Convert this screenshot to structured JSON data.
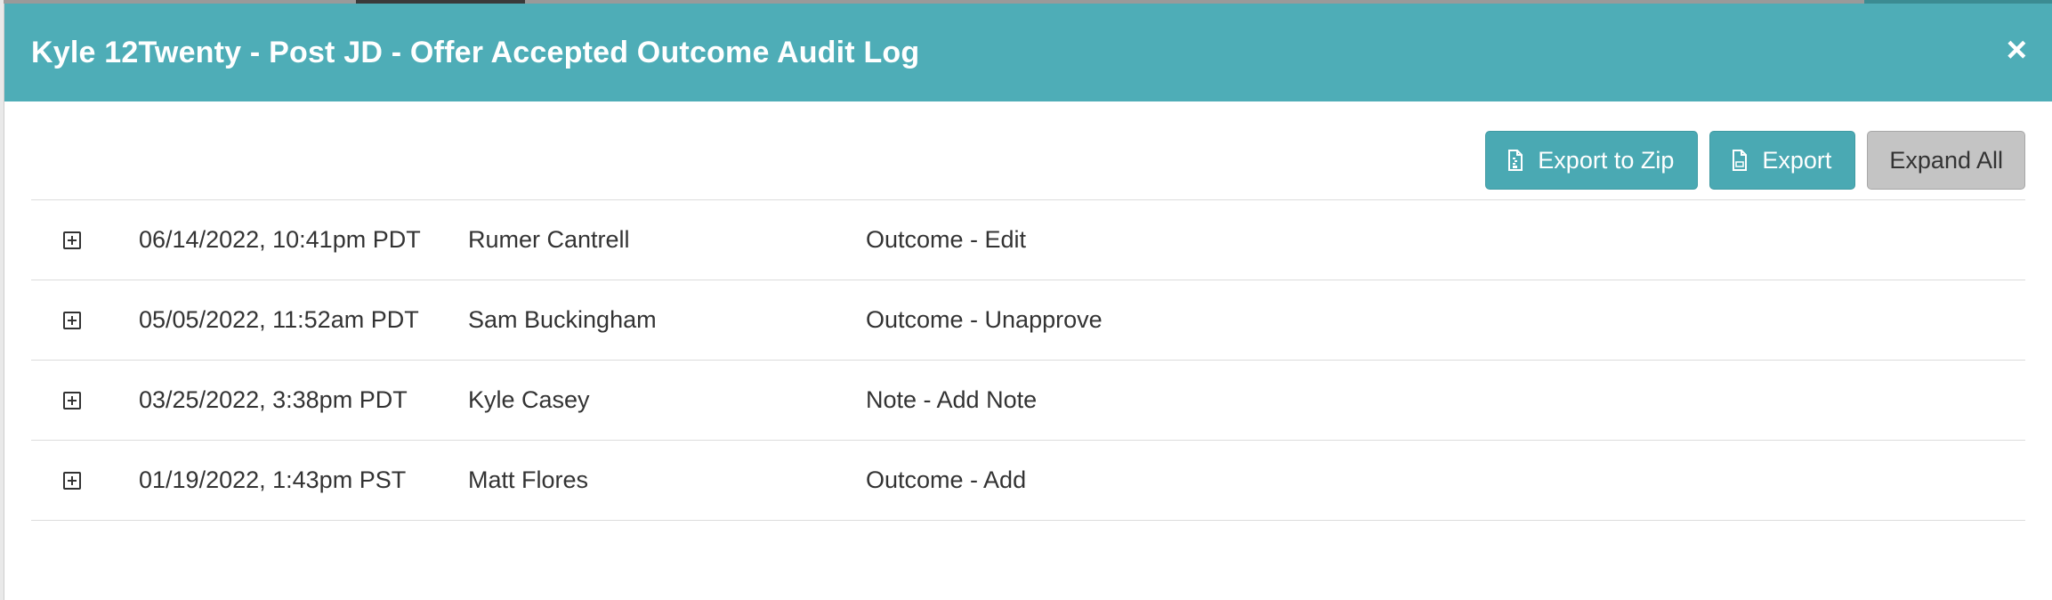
{
  "modal": {
    "title": "Kyle 12Twenty - Post JD - Offer Accepted Outcome Audit Log",
    "close_icon": "close-icon",
    "close_glyph": "×"
  },
  "toolbar": {
    "export_zip_label": "Export to Zip",
    "export_zip_icon": "zip-file-icon",
    "export_label": "Export",
    "export_icon": "csv-file-icon",
    "expand_all_label": "Expand All"
  },
  "log": {
    "rows": [
      {
        "timestamp": "06/14/2022, 10:41pm PDT",
        "user": "Rumer Cantrell",
        "action": "Outcome - Edit"
      },
      {
        "timestamp": "05/05/2022, 11:52am PDT",
        "user": "Sam Buckingham",
        "action": "Outcome - Unapprove"
      },
      {
        "timestamp": "03/25/2022, 3:38pm PDT",
        "user": "Kyle Casey",
        "action": "Note - Add Note"
      },
      {
        "timestamp": "01/19/2022, 1:43pm PST",
        "user": "Matt Flores",
        "action": "Outcome - Add"
      }
    ]
  },
  "colors": {
    "header_bg": "#4eadb7",
    "button_teal": "#4aa9b3",
    "button_grey": "#c4c4c4"
  }
}
